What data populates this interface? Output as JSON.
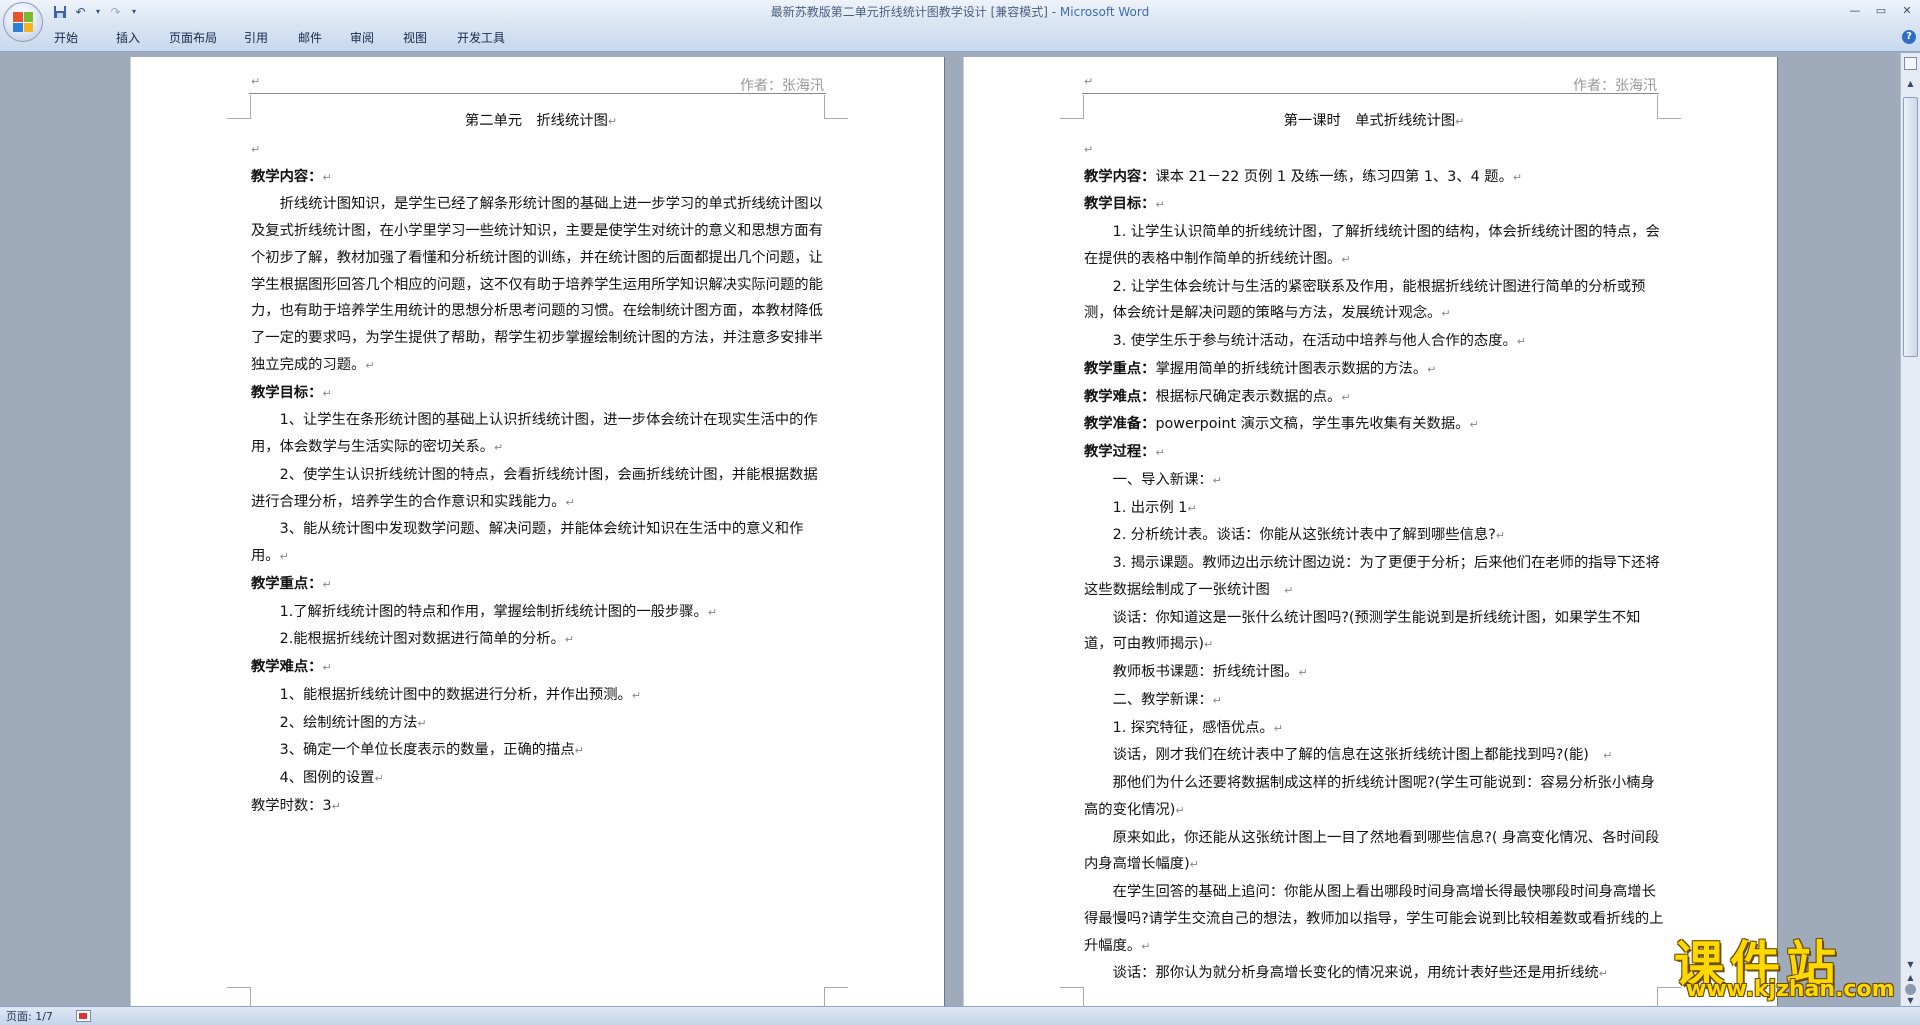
{
  "window": {
    "title_doc": "最新苏教版第二单元折线统计图教学设计 [兼容模式] - ",
    "title_app": "Microsoft Word"
  },
  "ribbon": {
    "tabs": [
      "开始",
      "插入",
      "页面布局",
      "引用",
      "邮件",
      "审阅",
      "视图",
      "开发工具"
    ]
  },
  "header": {
    "author": "作者：张海汛"
  },
  "pages": [
    {
      "paragraphs": [
        {
          "label": "",
          "text": "第二单元　折线统计图"
        },
        {
          "label": "",
          "text": ""
        },
        {
          "label": "教学内容：",
          "text": ""
        },
        {
          "label": "",
          "text": "折线统计图知识，是学生已经了解条形统计图的基础上进一步学习的单式折线统计图以及复式折线统计图，在小学里学习一些统计知识，主要是使学生对统计的意义和思想方面有个初步了解，教材加强了看懂和分析统计图的训练，并在统计图的后面都提出几个问题，让学生根据图形回答几个相应的问题，这不仅有助于培养学生运用所学知识解决实际问题的能力，也有助于培养学生用统计的思想分析思考问题的习惯。在绘制统计图方面，本教材降低了一定的要求吗，为学生提供了帮助，帮学生初步掌握绘制统计图的方法，并注意多安排半独立完成的习题。"
        },
        {
          "label": "教学目标：",
          "text": ""
        },
        {
          "label": "",
          "text": "1、让学生在条形统计图的基础上认识折线统计图，进一步体会统计在现实生活中的作用，体会数学与生活实际的密切关系。"
        },
        {
          "label": "",
          "text": "2、使学生认识折线统计图的特点，会看折线统计图，会画折线统计图，并能根据数据进行合理分析，培养学生的合作意识和实践能力。"
        },
        {
          "label": "",
          "text": "3、能从统计图中发现数学问题、解决问题，并能体会统计知识在生活中的意义和作用。"
        },
        {
          "label": "教学重点：",
          "text": ""
        },
        {
          "label": "",
          "text": "1.了解折线统计图的特点和作用，掌握绘制折线统计图的一般步骤。"
        },
        {
          "label": "",
          "text": "2.能根据折线统计图对数据进行简单的分析。"
        },
        {
          "label": "教学难点：",
          "text": ""
        },
        {
          "label": "",
          "text": "1、能根据折线统计图中的数据进行分析，并作出预测。"
        },
        {
          "label": "",
          "text": "2、绘制统计图的方法"
        },
        {
          "label": "",
          "text": "3、确定一个单位长度表示的数量，正确的描点"
        },
        {
          "label": "",
          "text": "4、图例的设置"
        },
        {
          "label": "",
          "text": "教学时数：3"
        }
      ]
    },
    {
      "paragraphs": [
        {
          "label": "",
          "text": "第一课时　单式折线统计图"
        },
        {
          "label": "",
          "text": ""
        },
        {
          "label": "教学内容：",
          "text": "课本 21－22 页例 1 及练一练，练习四第 1、3、4 题。"
        },
        {
          "label": "教学目标：",
          "text": ""
        },
        {
          "label": "",
          "text": "1. 让学生认识简单的折线统计图，了解折线统计图的结构，体会折线统计图的特点，会在提供的表格中制作简单的折线统计图。"
        },
        {
          "label": "",
          "text": "2. 让学生体会统计与生活的紧密联系及作用，能根据折线统计图进行简单的分析或预测，体会统计是解决问题的策略与方法，发展统计观念。"
        },
        {
          "label": "",
          "text": "3. 使学生乐于参与统计活动，在活动中培养与他人合作的态度。"
        },
        {
          "label": "教学重点：",
          "text": "掌握用简单的折线统计图表示数据的方法。"
        },
        {
          "label": "教学难点：",
          "text": "根据标尺确定表示数据的点。"
        },
        {
          "label": "教学准备：",
          "text": "powerpoint 演示文稿，学生事先收集有关数据。"
        },
        {
          "label": "教学过程：",
          "text": ""
        },
        {
          "label": "",
          "text": "一、导入新课："
        },
        {
          "label": "",
          "text": "1. 出示例 1"
        },
        {
          "label": "",
          "text": "2. 分析统计表。谈话：你能从这张统计表中了解到哪些信息?"
        },
        {
          "label": "",
          "text": "3. 揭示课题。教师边出示统计图边说：为了更便于分析；后来他们在老师的指导下还将这些数据绘制成了一张统计图　"
        },
        {
          "label": "",
          "text": "谈话：你知道这是一张什么统计图吗?(预测学生能说到是折线统计图，如果学生不知道，可由教师揭示)"
        },
        {
          "label": "",
          "text": "教师板书课题：折线统计图。"
        },
        {
          "label": "",
          "text": "二、教学新课："
        },
        {
          "label": "",
          "text": "1. 探究特征，感悟优点。"
        },
        {
          "label": "",
          "text": "谈话，刚才我们在统计表中了解的信息在这张折线统计图上都能找到吗?(能)　"
        },
        {
          "label": "",
          "text": "那他们为什么还要将数据制成这样的折线统计图呢?(学生可能说到：容易分析张小楠身高的变化情况)"
        },
        {
          "label": "",
          "text": "原来如此，你还能从这张统计图上一目了然地看到哪些信息?( 身高变化情况、各时间段内身高增长幅度)"
        },
        {
          "label": "",
          "text": "在学生回答的基础上追问：你能从图上看出哪段时间身高增长得最快哪段时间身高增长得最慢吗?请学生交流自己的想法，教师加以指导，学生可能会说到比较相差数或看折线的上升幅度。"
        },
        {
          "label": "",
          "text": "谈话：那你认为就分析身高增长变化的情况来说，用统计表好些还是用折线统"
        }
      ]
    }
  ],
  "status": {
    "page_info": "页面: 1/7"
  },
  "watermark": {
    "text": "课件站",
    "url": "www.kjzhan.com"
  }
}
